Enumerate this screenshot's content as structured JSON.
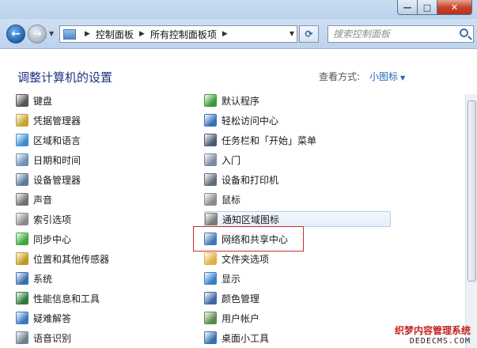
{
  "window": {
    "min_label": "—",
    "max_label": "□",
    "close_label": "✕"
  },
  "nav": {
    "back_icon": "back-arrow-icon",
    "forward_icon": "forward-arrow-icon",
    "breadcrumbs": [
      "控制面板",
      "所有控制面板项"
    ],
    "search_placeholder": "搜索控制面板"
  },
  "header": {
    "title": "调整计算机的设置",
    "view_label": "查看方式:",
    "view_value": "小图标"
  },
  "items": {
    "left": [
      {
        "label": "键盘",
        "icon": "keyboard-icon",
        "color": "#555"
      },
      {
        "label": "凭据管理器",
        "icon": "credential-icon",
        "color": "#c8a030"
      },
      {
        "label": "区域和语言",
        "icon": "globe-icon",
        "color": "#3a8fd0"
      },
      {
        "label": "日期和时间",
        "icon": "clock-icon",
        "color": "#6a8fb8"
      },
      {
        "label": "设备管理器",
        "icon": "device-manager-icon",
        "color": "#5a7a9a"
      },
      {
        "label": "声音",
        "icon": "speaker-icon",
        "color": "#707070"
      },
      {
        "label": "索引选项",
        "icon": "index-search-icon",
        "color": "#8a8a8a"
      },
      {
        "label": "同步中心",
        "icon": "sync-icon",
        "color": "#3aa83a"
      },
      {
        "label": "位置和其他传感器",
        "icon": "sensor-icon",
        "color": "#c09a20"
      },
      {
        "label": "系统",
        "icon": "system-icon",
        "color": "#3a6fb0"
      },
      {
        "label": "性能信息和工具",
        "icon": "performance-icon",
        "color": "#2f7a3a"
      },
      {
        "label": "疑难解答",
        "icon": "troubleshoot-icon",
        "color": "#3a78c0"
      },
      {
        "label": "语音识别",
        "icon": "microphone-icon",
        "color": "#6f7f90"
      }
    ],
    "right": [
      {
        "label": "默认程序",
        "icon": "default-programs-icon",
        "color": "#3a9a3a"
      },
      {
        "label": "轻松访问中心",
        "icon": "ease-of-access-icon",
        "color": "#3a70b8"
      },
      {
        "label": "任务栏和「开始」菜单",
        "icon": "taskbar-icon",
        "color": "#4a5a70"
      },
      {
        "label": "入门",
        "icon": "getting-started-icon",
        "color": "#7a8aa0"
      },
      {
        "label": "设备和打印机",
        "icon": "printer-icon",
        "color": "#606a78"
      },
      {
        "label": "鼠标",
        "icon": "mouse-icon",
        "color": "#8a8a8a"
      },
      {
        "label": "通知区域图标",
        "icon": "notification-icon",
        "color": "#7a7a7a"
      },
      {
        "label": "网络和共享中心",
        "icon": "network-icon",
        "color": "#3f78b8"
      },
      {
        "label": "文件夹选项",
        "icon": "folder-icon",
        "color": "#e0b040"
      },
      {
        "label": "显示",
        "icon": "display-icon",
        "color": "#3a80c8"
      },
      {
        "label": "颜色管理",
        "icon": "color-management-icon",
        "color": "#4068a8"
      },
      {
        "label": "用户帐户",
        "icon": "user-accounts-icon",
        "color": "#5a8a4a"
      },
      {
        "label": "桌面小工具",
        "icon": "gadgets-icon",
        "color": "#3a70b0"
      }
    ]
  },
  "watermark": {
    "line1": "织梦内容管理系统",
    "line2": "DEDECMS.COM"
  }
}
